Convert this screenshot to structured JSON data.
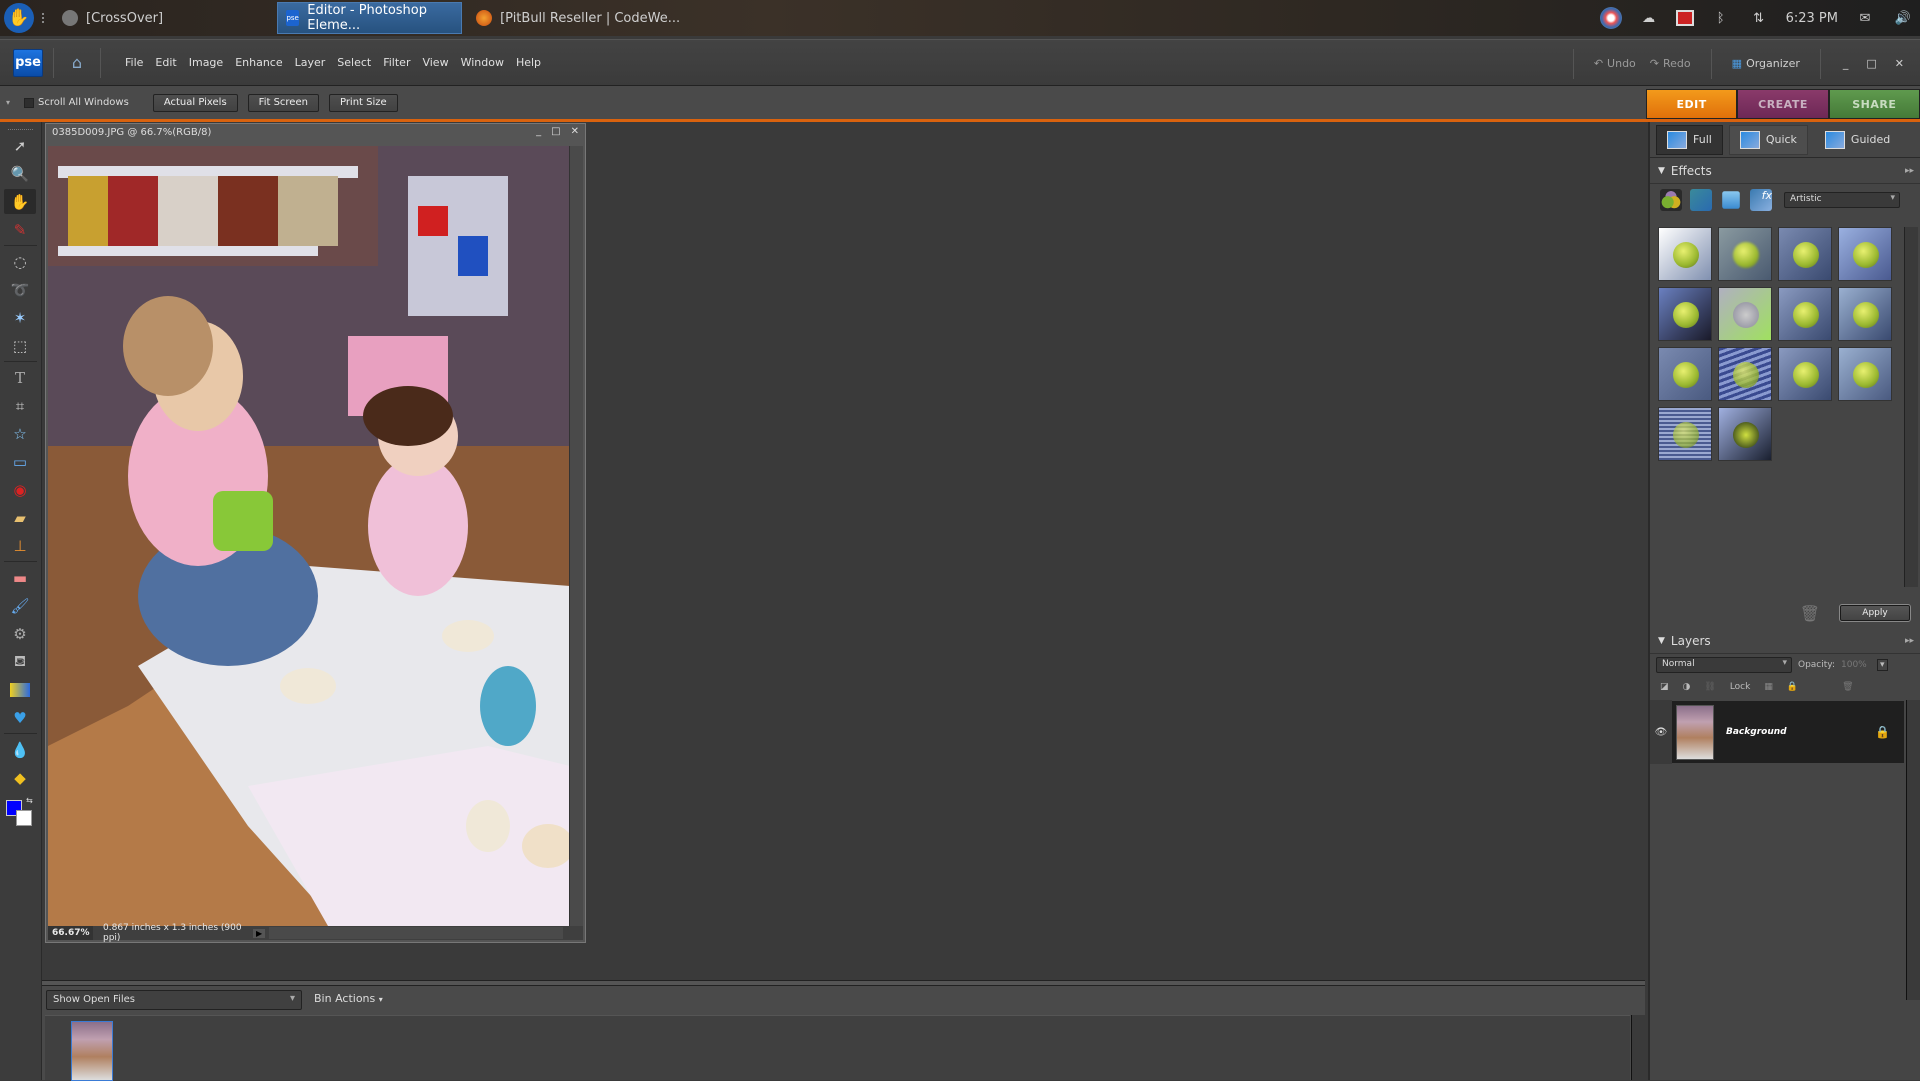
{
  "os_panel": {
    "tasks": [
      {
        "label": "[CrossOver]",
        "active": false
      },
      {
        "label": "Editor - Photoshop Eleme...",
        "active": true
      },
      {
        "label": "[PitBull Reseller | CodeWe...",
        "active": false
      }
    ],
    "clock": "6:23 PM",
    "tray_icons": [
      "chromium-icon",
      "weather-icon",
      "record-stop-icon",
      "bluetooth-icon",
      "network-icon",
      "mail-icon",
      "volume-icon"
    ]
  },
  "app": {
    "logo_text": "pse",
    "menu": [
      "File",
      "Edit",
      "Image",
      "Enhance",
      "Layer",
      "Select",
      "Filter",
      "View",
      "Window",
      "Help"
    ],
    "undo_label": "Undo",
    "redo_label": "Redo",
    "organizer_label": "Organizer"
  },
  "options_bar": {
    "scroll_all_label": "Scroll All Windows",
    "scroll_all_checked": false,
    "buttons": [
      "Actual Pixels",
      "Fit Screen",
      "Print Size"
    ]
  },
  "mode_tabs": [
    {
      "label": "EDIT",
      "color": "#e0700a",
      "active": true
    },
    {
      "label": "CREATE",
      "color": "#7a2f5f",
      "active": false
    },
    {
      "label": "SHARE",
      "color": "#4f8a3f",
      "active": false
    }
  ],
  "edit_subtabs": [
    {
      "label": "Full",
      "active": true
    },
    {
      "label": "Quick",
      "active": false
    },
    {
      "label": "Guided",
      "active": false
    }
  ],
  "tools": [
    "move-tool",
    "zoom-tool",
    "hand-tool",
    "eyedropper-tool",
    "marquee-tool",
    "lasso-tool",
    "magic-wand-tool",
    "selection-brush-tool",
    "type-tool",
    "crop-tool",
    "cookie-cutter-tool",
    "straighten-tool",
    "red-eye-tool",
    "healing-brush-tool",
    "clone-stamp-tool",
    "eraser-tool",
    "brush-tool",
    "impressionist-brush-tool",
    "paint-bucket-tool",
    "gradient-tool",
    "shape-tool",
    "blur-tool",
    "sponge-tool"
  ],
  "colors": {
    "foreground": "#0000ff",
    "background": "#ffffff",
    "accent": "#d9620e"
  },
  "document": {
    "title": "0385D009.JPG @ 66.7%(RGB/8)",
    "zoom": "66.67%",
    "size_info": "0.867 inches x 1.3 inches (900 ppi)"
  },
  "effects_panel": {
    "title": "Effects",
    "category": "Artistic",
    "thumbnail_count": 14,
    "apply_label": "Apply"
  },
  "layers_panel": {
    "title": "Layers",
    "blend_mode": "Normal",
    "opacity_label": "Opacity:",
    "opacity_value": "100%",
    "lock_label": "Lock",
    "layers": [
      {
        "name": "Background",
        "visible": true,
        "locked": true
      }
    ]
  },
  "project_bin": {
    "show_label": "Show Open Files",
    "actions_label": "Bin Actions"
  }
}
